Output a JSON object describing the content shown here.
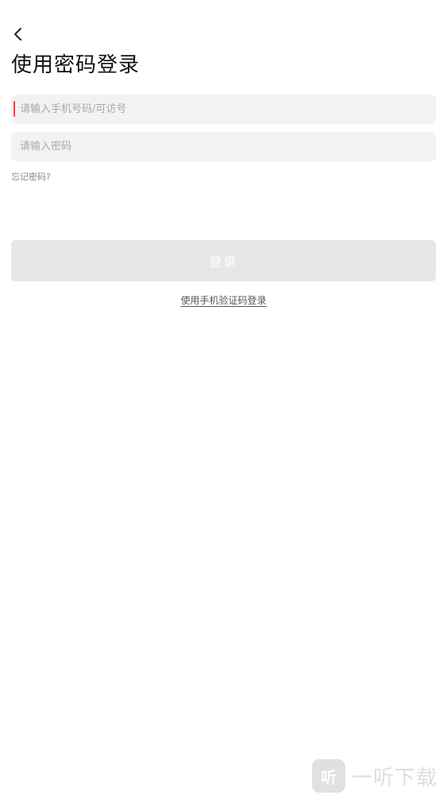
{
  "header": {
    "back_icon": "chevron-left-icon",
    "title": "使用密码登录"
  },
  "form": {
    "phone_placeholder": "请输入手机号码/可访号",
    "phone_value": "",
    "password_placeholder": "请输入密码",
    "password_value": "",
    "forgot_label": "忘记密码?",
    "login_label": "登录",
    "sms_login_label": "使用手机验证码登录"
  },
  "watermark": {
    "logo_text": "听",
    "text": "一听下载"
  },
  "colors": {
    "caret": "#e8474f",
    "field_bg": "#f2f2f2",
    "button_disabled_bg": "#e6e6e6"
  }
}
